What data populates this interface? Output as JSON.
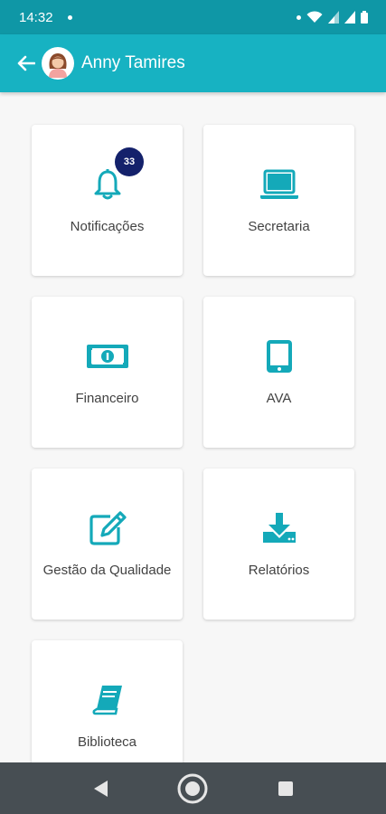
{
  "status_bar": {
    "time": "14:32"
  },
  "header": {
    "user_name": "Anny Tamires"
  },
  "colors": {
    "primary": "#17b2c2",
    "status": "#0f97a6",
    "icon": "#14a9b9",
    "badge": "#14216b",
    "nav": "#474e53"
  },
  "tiles": [
    {
      "label": "Notificações",
      "icon": "bell-icon",
      "badge": "33"
    },
    {
      "label": "Secretaria",
      "icon": "laptop-icon"
    },
    {
      "label": "Financeiro",
      "icon": "money-icon"
    },
    {
      "label": "AVA",
      "icon": "tablet-icon"
    },
    {
      "label": "Gestão da Qualidade",
      "icon": "edit-icon"
    },
    {
      "label": "Relatórios",
      "icon": "download-icon"
    },
    {
      "label": "Biblioteca",
      "icon": "book-icon"
    }
  ],
  "nav": {
    "back": "back-icon",
    "home": "home-icon",
    "recents": "recents-icon"
  }
}
